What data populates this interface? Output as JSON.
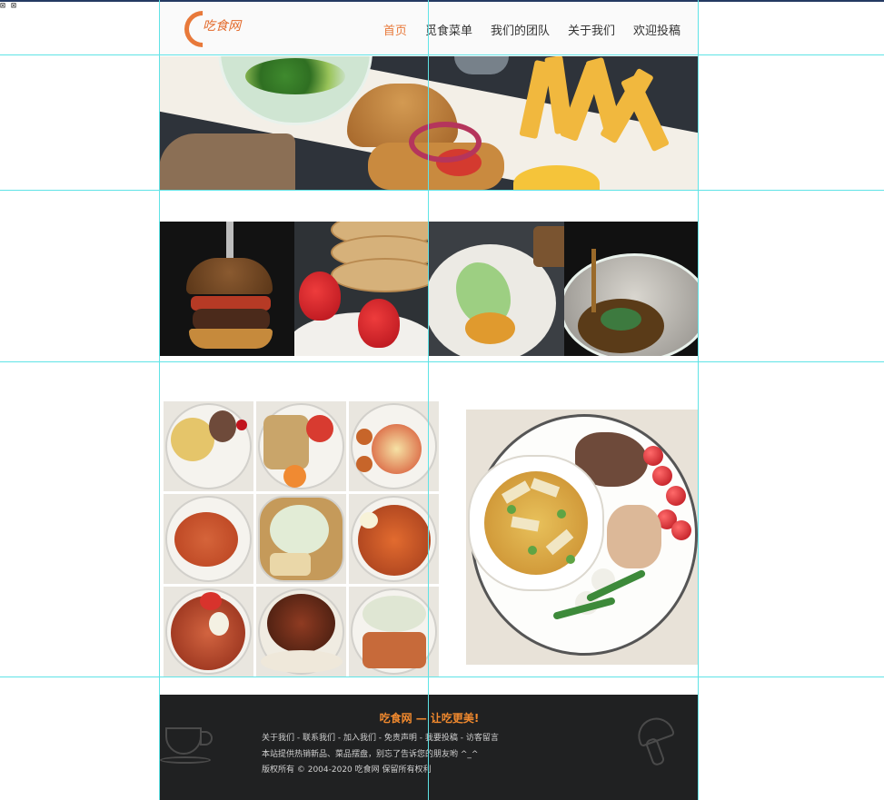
{
  "browser_icons": [
    "broken-image-icon",
    "broken-image-icon"
  ],
  "header": {
    "logo_text": "吃食网",
    "nav": [
      {
        "label": "首页",
        "active": true
      },
      {
        "label": "觅食菜单",
        "active": false
      },
      {
        "label": "我们的团队",
        "active": false
      },
      {
        "label": "关于我们",
        "active": false
      },
      {
        "label": "欢迎投稿",
        "active": false
      }
    ]
  },
  "banner": {
    "subject": "salad-burger-fries-photo"
  },
  "gallery_row": [
    {
      "subject": "burger-photo"
    },
    {
      "subject": "strawberry-pancake-photo"
    },
    {
      "subject": "plated-vegetable-dish-photo"
    },
    {
      "subject": "soup-bowl-photo"
    }
  ],
  "grid_photos": [
    {
      "subject": "dish-photo-1"
    },
    {
      "subject": "dish-photo-2"
    },
    {
      "subject": "dish-photo-3"
    },
    {
      "subject": "dish-photo-4"
    },
    {
      "subject": "dish-photo-5"
    },
    {
      "subject": "dish-photo-6"
    },
    {
      "subject": "dish-photo-7"
    },
    {
      "subject": "dish-photo-8"
    },
    {
      "subject": "dish-photo-9"
    }
  ],
  "feature_photo": {
    "subject": "soup-and-beef-platter-photo"
  },
  "footer": {
    "title": "吃食网 — 让吃更美!",
    "links": "关于我们 - 联系我们 - 加入我们 - 免责声明 - 我要投稿 - 访客留言",
    "tagline": "本站提供热销新品、菜品摆盘，别忘了告诉您的朋友哟 ^_^",
    "copyright": "版权所有 © 2004-2020 吃食网 保留所有权利"
  },
  "colors": {
    "accent": "#e8793a",
    "guide": "#5fe3e6",
    "footer_bg": "#202122",
    "footer_title": "#f0892e"
  }
}
